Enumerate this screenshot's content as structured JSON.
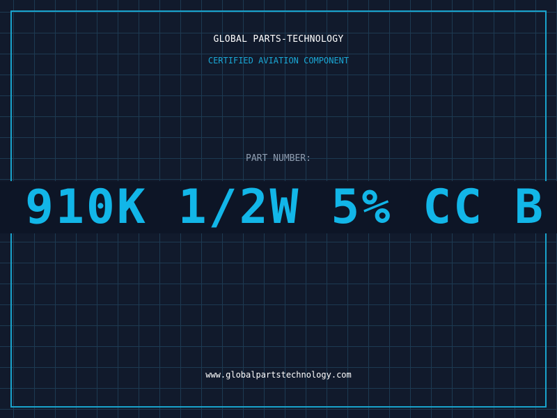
{
  "header": {
    "company": "GLOBAL PARTS-TECHNOLOGY",
    "subtitle": "CERTIFIED AVIATION COMPONENT"
  },
  "part": {
    "label": "PART NUMBER:",
    "number": "910K 1/2W 5% CC B"
  },
  "footer": {
    "website": "www.globalpartstechnology.com"
  },
  "colors": {
    "background": "#111a2c",
    "grid": "#1d3a52",
    "accent": "#19a3cc",
    "part_number": "#12b6e8",
    "band": "#0d1526"
  }
}
